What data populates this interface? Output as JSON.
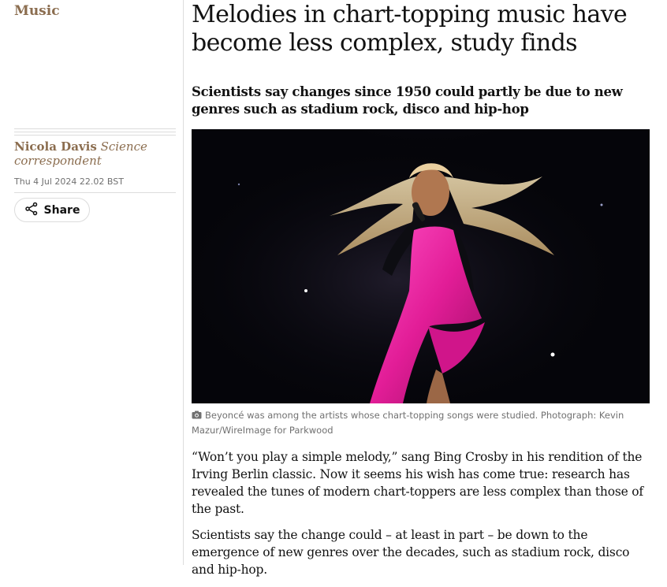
{
  "section": {
    "label": "Music"
  },
  "byline": {
    "name": "Nicola Davis",
    "role": "Science correspondent"
  },
  "dateline": "Thu 4 Jul 2024 22.02 BST",
  "share": {
    "label": "Share",
    "icon": "share-icon"
  },
  "article": {
    "headline": "Melodies in chart-topping music have become less complex, study finds",
    "standfirst": "Scientists say changes since 1950 could partly be due to new genres such as stadium rock, disco and hip-hop",
    "image": {
      "caption": "Beyoncé was among the artists whose chart-topping songs were studied. Photograph: Kevin Mazur/WireImage for Parkwood",
      "caption_icon": "camera-icon"
    },
    "paragraphs": [
      "“Won’t you play a simple melody,” sang Bing Crosby in his rendition of the Irving Berlin classic. Now it seems his wish has come true: research has revealed the tunes of modern chart-toppers are less complex than those of the past.",
      "Scientists say the change could – at least in part – be down to the emergence of new genres over the decades, such as stadium rock, disco and hip-hop."
    ]
  },
  "colors": {
    "accent": "#8b6d4f",
    "text": "#121212",
    "muted": "#707070",
    "rule": "#dcdcdc"
  }
}
